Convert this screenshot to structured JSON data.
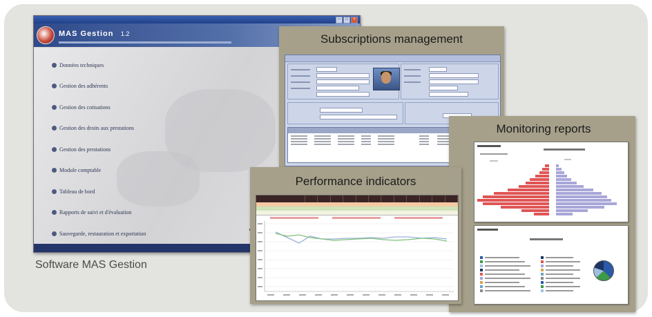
{
  "caption": "Software MAS Gestion",
  "mas_window": {
    "banner_title": "MAS Gestion",
    "banner_version": "1.2",
    "menu": [
      "Données techniques",
      "Gestion des adhérents",
      "Gestion des cotisations",
      "Gestion des droits aux prestations",
      "Gestion des prestations",
      "Module comptable",
      "Tableau de bord",
      "Rapports de suivi et d'évaluation",
      "Sauvegarde, restauration et exportation"
    ]
  },
  "cards": {
    "subscriptions": {
      "title": "Subscriptions management"
    },
    "monitoring": {
      "title": "Monitoring reports"
    },
    "performance": {
      "title": "Performance indicators"
    }
  },
  "colors": {
    "card_bg": "#a6a08a",
    "outer_panel": "#e3e3df",
    "banner_blue": "#2f4a8a",
    "report_red": "#e05555",
    "report_lavender": "#a8a6d8",
    "perf_line_1": "#9ab0d8",
    "perf_line_2": "#7fc17a"
  }
}
